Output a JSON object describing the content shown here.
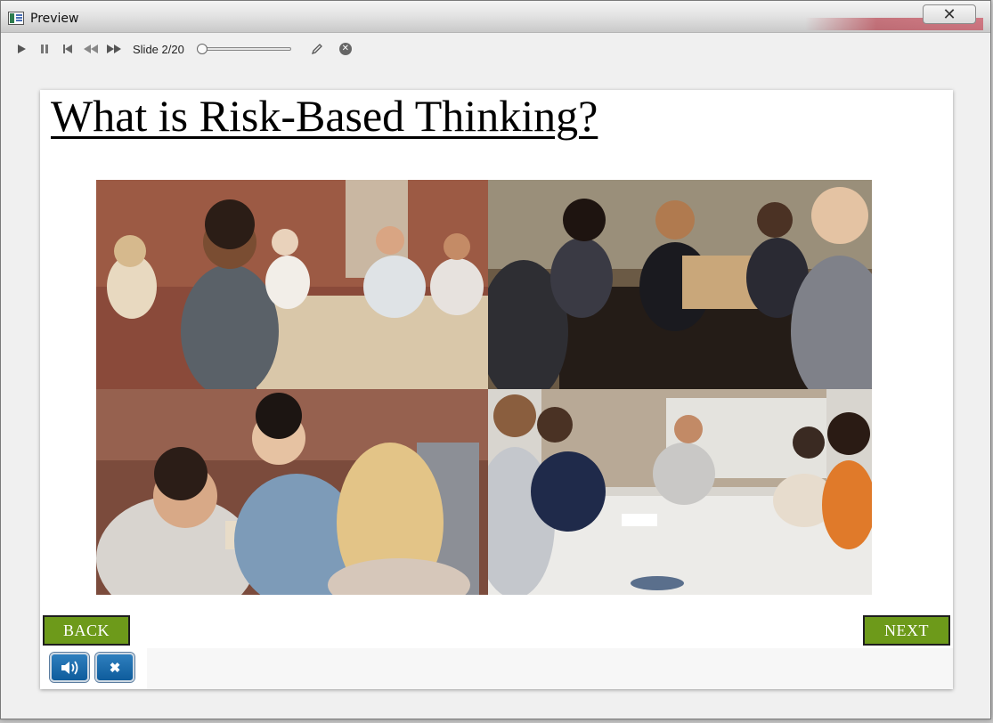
{
  "window": {
    "title": "Preview",
    "close_glyph": "✕"
  },
  "toolbar": {
    "play_icon": "play-icon",
    "pause_icon": "pause-icon",
    "first_icon": "skip-to-start-icon",
    "rewind_icon": "rewind-icon",
    "forward_icon": "fast-forward-icon",
    "slide_counter": "Slide 2/20",
    "progress_fraction": 0.0,
    "edit_icon": "pencil-icon",
    "stop_icon": "circle-x-icon"
  },
  "slide": {
    "title": "What is Risk-Based Thinking?",
    "photos": [
      {
        "name": "photo-meeting-applause"
      },
      {
        "name": "photo-team-laptop-discussion"
      },
      {
        "name": "photo-coworkers-coffee-chat"
      },
      {
        "name": "photo-conference-table-meeting"
      }
    ],
    "back_label": "BACK",
    "next_label": "NEXT",
    "audio_icon": "speaker-icon",
    "close_glyph": "✖"
  },
  "colors": {
    "nav_green": "#6d9a1a",
    "control_blue": "#0e5c9c"
  }
}
